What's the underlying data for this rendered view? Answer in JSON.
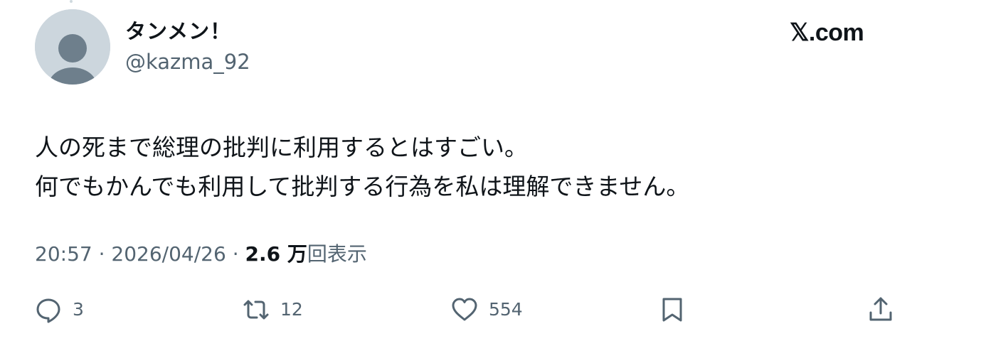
{
  "author": {
    "display_name": "タンメン！",
    "handle": "@kazma_92"
  },
  "brand": {
    "label": "𝕏.com"
  },
  "tweet": {
    "lines": [
      "人の死まで総理の批判に利用するとはすごい。",
      "何でもかんでも利用して批判する行為を私は理解できません。"
    ]
  },
  "meta": {
    "time": "20:57",
    "separator_1": " · ",
    "date": "2026/04/26",
    "separator_2": " · ",
    "views_count": "2.6 万",
    "views_label": "回表示"
  },
  "actions": {
    "reply": {
      "icon": "reply-icon",
      "count": "3"
    },
    "retweet": {
      "icon": "retweet-icon",
      "count": "12"
    },
    "like": {
      "icon": "heart-icon",
      "count": "554"
    },
    "bookmark": {
      "icon": "bookmark-icon"
    },
    "share": {
      "icon": "share-icon"
    }
  },
  "colors": {
    "text_primary": "#0f1419",
    "text_secondary": "#536471",
    "avatar_bg": "#ccd6dd",
    "avatar_figure": "#6e7f8c"
  }
}
